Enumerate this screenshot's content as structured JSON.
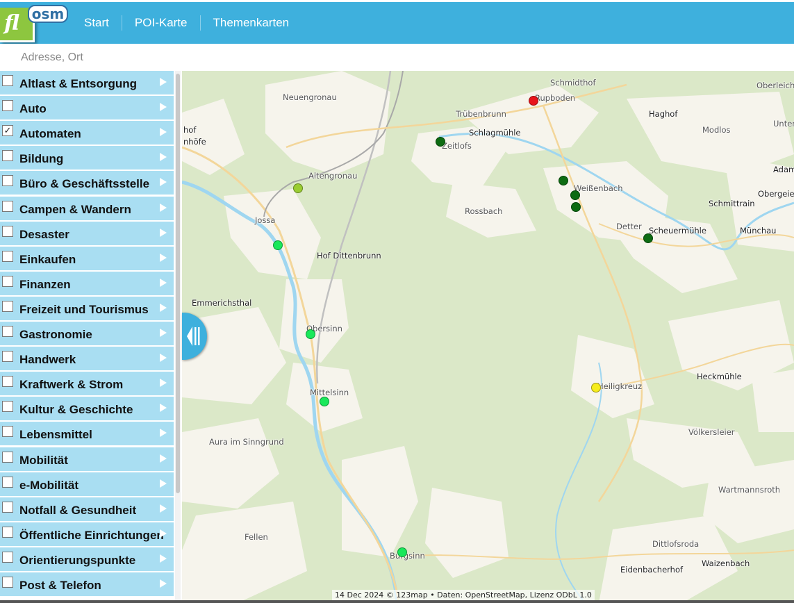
{
  "app": {
    "logo_text_fl": "fl",
    "logo_text_osm": "osm"
  },
  "nav": {
    "items": [
      "Start",
      "POI-Karte",
      "Themenkarten"
    ]
  },
  "search": {
    "placeholder": "Adresse, Ort",
    "value": ""
  },
  "sidebar": {
    "categories": [
      {
        "label": "Altlast & Entsorgung",
        "checked": false
      },
      {
        "label": "Auto",
        "checked": false
      },
      {
        "label": "Automaten",
        "checked": true
      },
      {
        "label": "Bildung",
        "checked": false
      },
      {
        "label": "Büro & Geschäftsstelle",
        "checked": false
      },
      {
        "label": "Campen & Wandern",
        "checked": false
      },
      {
        "label": "Desaster",
        "checked": false
      },
      {
        "label": "Einkaufen",
        "checked": false
      },
      {
        "label": "Finanzen",
        "checked": false
      },
      {
        "label": "Freizeit und Tourismus",
        "checked": false
      },
      {
        "label": "Gastronomie",
        "checked": false
      },
      {
        "label": "Handwerk",
        "checked": false
      },
      {
        "label": "Kraftwerk & Strom",
        "checked": false
      },
      {
        "label": "Kultur & Geschichte",
        "checked": false
      },
      {
        "label": "Lebensmittel",
        "checked": false
      },
      {
        "label": "Mobilität",
        "checked": false
      },
      {
        "label": "e-Mobilität",
        "checked": false
      },
      {
        "label": "Notfall & Gesundheit",
        "checked": false
      },
      {
        "label": "Öffentliche Einrichtungen",
        "checked": false
      },
      {
        "label": "Orientierungspunkte",
        "checked": false
      },
      {
        "label": "Post & Telefon",
        "checked": false
      }
    ]
  },
  "map": {
    "places": [
      "Schmidthof",
      "Oberleichtersbach",
      "Rupboden",
      "Neuengronau",
      "Trübenbrunn",
      "Haghof",
      "Modlos",
      "Unterer",
      "Schlagmühle",
      "Zeitlofs",
      "hof",
      "nhöfe",
      "Altengronau",
      "Adam",
      "Obergeiersnest",
      "Weißenbach",
      "Schmittrain",
      "Rossbach",
      "Jossa",
      "Detter",
      "Scheuermühle",
      "Münchau",
      "Hof Dittenbrunn",
      "Emmerichsthal",
      "Obersinn",
      "Heckmühle",
      "Heiligkreuz",
      "Mittelsinn",
      "Aura im Sinngrund",
      "Völkersleier",
      "Wartmannsroth",
      "Fellen",
      "Dittlofsroda",
      "Burgsinn",
      "Eidenbacherhof",
      "Waizenbach"
    ],
    "poi_colors": {
      "red": "#e8141b",
      "dark_green": "#0d6b12",
      "yellow_green": "#9acd32",
      "bright_green": "#19e85a",
      "yellow": "#f6ec1c"
    },
    "attribution": "14 Dec 2024 © 123map • Daten: OpenStreetMap, Lizenz ODbL 1.0"
  }
}
